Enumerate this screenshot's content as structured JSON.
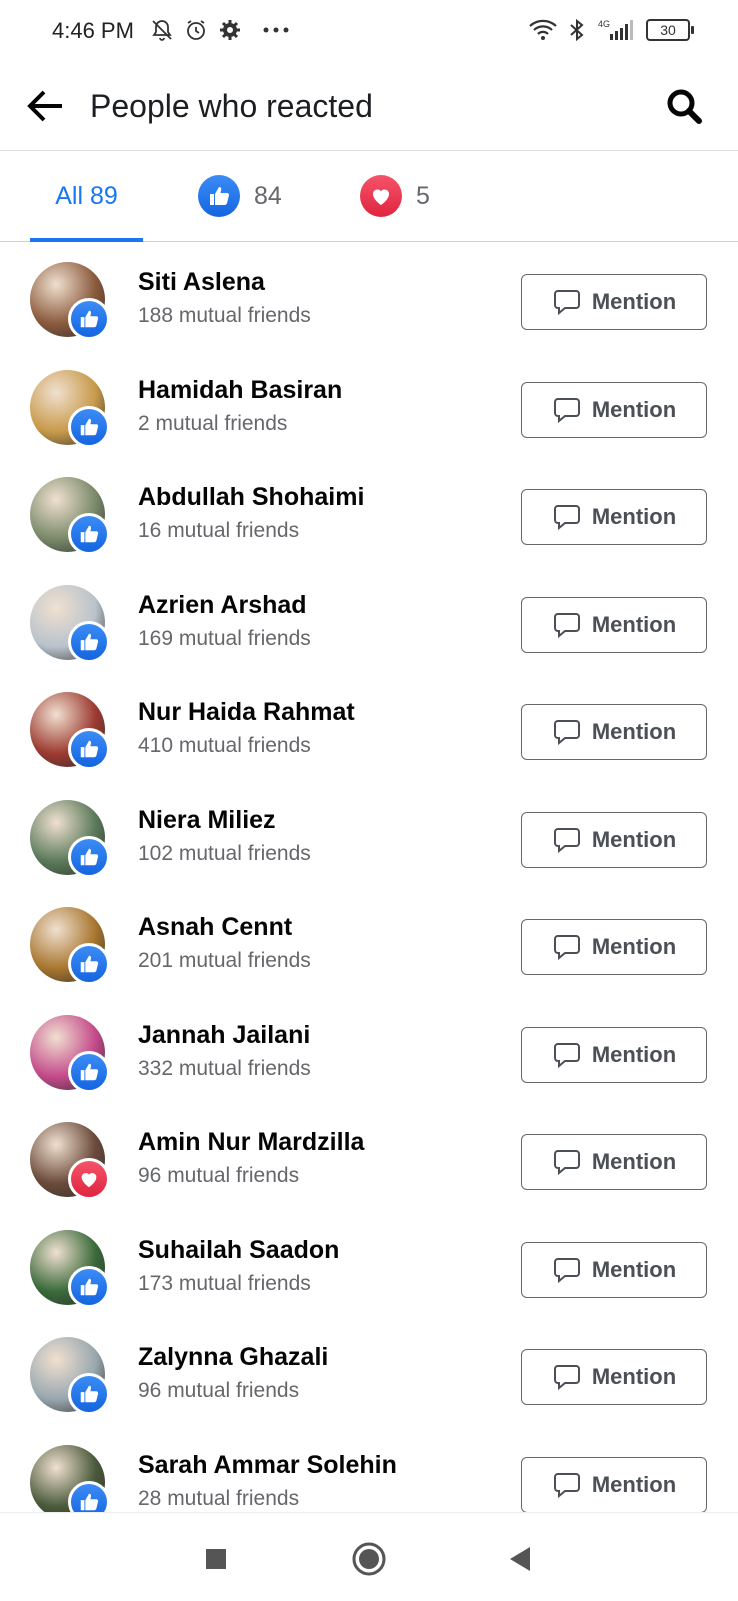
{
  "status_bar": {
    "time": "4:46 PM",
    "battery": "30",
    "network": "4G",
    "icons": [
      "mute-bell-icon",
      "alarm-icon",
      "gear-icon",
      "more-dots-icon",
      "wifi-icon",
      "bluetooth-icon",
      "signal-icon",
      "battery-icon"
    ]
  },
  "header": {
    "title": "People who reacted",
    "back_icon": "arrow-left-icon",
    "search_icon": "search-icon"
  },
  "tabs": [
    {
      "label": "All 89",
      "active": true
    },
    {
      "icon": "like-icon",
      "count": "84"
    },
    {
      "icon": "love-icon",
      "count": "5"
    }
  ],
  "colors": {
    "accent": "#1877f2",
    "like": "#1877f2",
    "love": "#f02849",
    "secondary_text": "#65676b"
  },
  "mention_label": "Mention",
  "people": [
    {
      "name": "Siti Aslena",
      "mutual": "188 mutual friends",
      "reaction": "like",
      "avatar_color": "#8a5a3c"
    },
    {
      "name": "Hamidah Basiran",
      "mutual": "2 mutual friends",
      "reaction": "like",
      "avatar_color": "#c89a4a"
    },
    {
      "name": "Abdullah Shohaimi",
      "mutual": "16 mutual friends",
      "reaction": "like",
      "avatar_color": "#7a8a6a"
    },
    {
      "name": "Azrien Arshad",
      "mutual": "169 mutual friends",
      "reaction": "like",
      "avatar_color": "#b9c3cc"
    },
    {
      "name": "Nur Haida Rahmat",
      "mutual": "410 mutual friends",
      "reaction": "like",
      "avatar_color": "#9c3a30"
    },
    {
      "name": "Niera Miliez",
      "mutual": "102 mutual friends",
      "reaction": "like",
      "avatar_color": "#5a7a5a"
    },
    {
      "name": "Asnah Cennt",
      "mutual": "201 mutual friends",
      "reaction": "like",
      "avatar_color": "#a8762e"
    },
    {
      "name": "Jannah Jailani",
      "mutual": "332 mutual friends",
      "reaction": "like",
      "avatar_color": "#c44a8a"
    },
    {
      "name": "Amin Nur Mardzilla",
      "mutual": "96 mutual friends",
      "reaction": "love",
      "avatar_color": "#6a4a3a"
    },
    {
      "name": "Suhailah Saadon",
      "mutual": "173 mutual friends",
      "reaction": "like",
      "avatar_color": "#3a6a3a"
    },
    {
      "name": "Zalynna Ghazali",
      "mutual": "96 mutual friends",
      "reaction": "like",
      "avatar_color": "#9aa8b0"
    },
    {
      "name": "Sarah Ammar Solehin",
      "mutual": "28 mutual friends",
      "reaction": "like",
      "avatar_color": "#4a5a3a"
    }
  ],
  "nav_bar": {
    "icons": [
      "recents-square-icon",
      "home-circle-icon",
      "back-triangle-icon"
    ]
  }
}
